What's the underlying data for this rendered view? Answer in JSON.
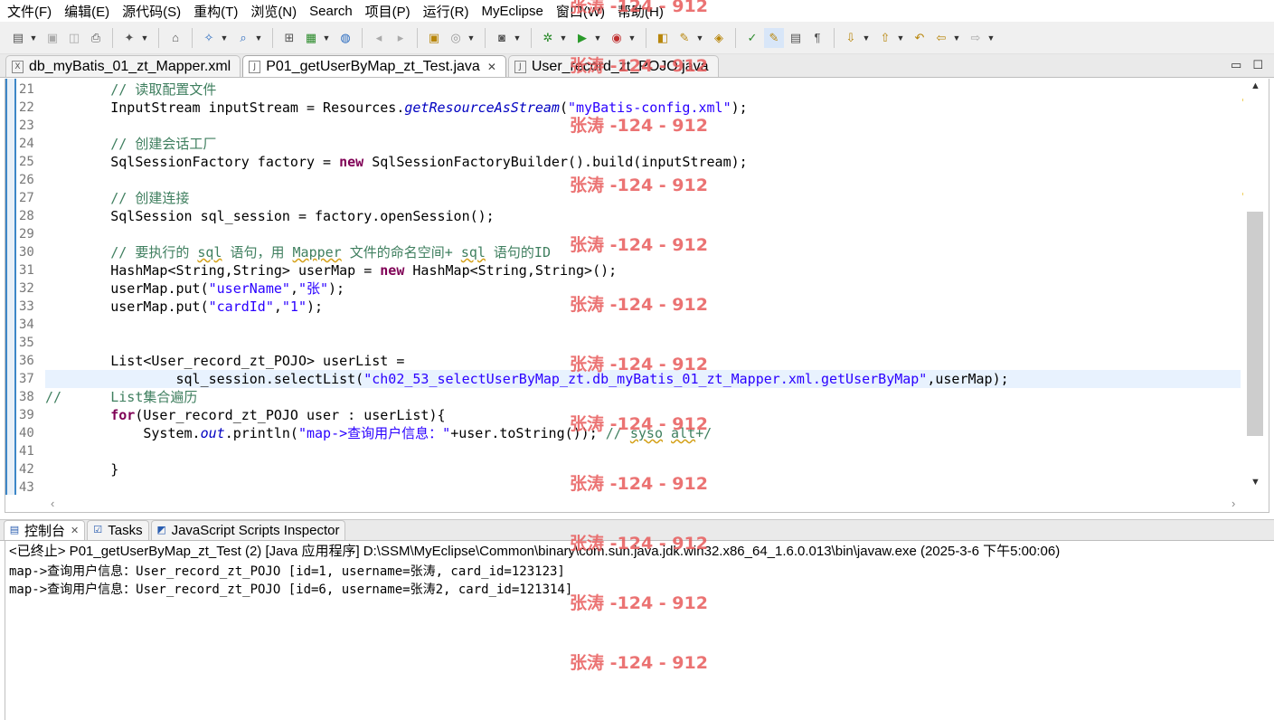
{
  "menu": {
    "items": [
      "文件(F)",
      "编辑(E)",
      "源代码(S)",
      "重构(T)",
      "浏览(N)",
      "Search",
      "项目(P)",
      "运行(R)",
      "MyEclipse",
      "窗口(W)",
      "帮助(H)"
    ]
  },
  "toolbar": {
    "buttons": [
      "new-icon",
      "save-icon",
      "save-all-icon",
      "print-icon",
      "new-project-icon",
      "terminal-icon",
      "open-type-icon",
      "search-icon",
      "deploy-icon",
      "server-icon",
      "globe-icon",
      "back-history-icon",
      "forward-history-icon",
      "package-icon",
      "browser-icon",
      "camera-icon",
      "debug-icon",
      "run-icon",
      "external-tools-icon",
      "open-folder-icon",
      "pen-icon",
      "bag-icon",
      "annotation-icon",
      "highlight-icon",
      "block-icon",
      "format-icon",
      "next-annotation-icon",
      "prev-annotation-icon",
      "last-edit-icon",
      "back-icon",
      "forward-icon"
    ]
  },
  "editor_tabs": [
    {
      "label": "db_myBatis_01_zt_Mapper.xml",
      "icon": "X",
      "active": false,
      "closable": false
    },
    {
      "label": "P01_getUserByMap_zt_Test.java",
      "icon": "J",
      "active": true,
      "closable": true
    },
    {
      "label": "User_record_zt_POJO.java",
      "icon": "J",
      "active": false,
      "closable": false
    }
  ],
  "window_controls": {
    "minimize": "▭",
    "maximize": "☐"
  },
  "code_lines": [
    {
      "no": "21",
      "text": "        // 读取配置文件"
    },
    {
      "no": "22",
      "text": "        InputStream inputStream = Resources.getResourceAsStream(\"myBatis-config.xml\");"
    },
    {
      "no": "23",
      "text": ""
    },
    {
      "no": "24",
      "text": "        // 创建会话工厂"
    },
    {
      "no": "25",
      "text": "        SqlSessionFactory factory = new SqlSessionFactoryBuilder().build(inputStream);"
    },
    {
      "no": "26",
      "text": ""
    },
    {
      "no": "27",
      "text": "        // 创建连接"
    },
    {
      "no": "28",
      "text": "        SqlSession sql_session = factory.openSession();"
    },
    {
      "no": "29",
      "text": ""
    },
    {
      "no": "30",
      "text": "        // 要执行的 sql 语句，用 Mapper 文件的命名空间+ sql 语句的ID"
    },
    {
      "no": "31",
      "text": "        HashMap<String,String> userMap = new HashMap<String,String>();"
    },
    {
      "no": "32",
      "text": "        userMap.put(\"userName\",\"张\");"
    },
    {
      "no": "33",
      "text": "        userMap.put(\"cardId\",\"1\");"
    },
    {
      "no": "34",
      "text": ""
    },
    {
      "no": "35",
      "text": ""
    },
    {
      "no": "36",
      "text": "        List<User_record_zt_POJO> userList ="
    },
    {
      "no": "37",
      "text": "                sql_session.selectList(\"ch02_53_selectUserByMap_zt.db_myBatis_01_zt_Mapper.xml.getUserByMap\",userMap);"
    },
    {
      "no": "38",
      "text": "//      List集合遍历"
    },
    {
      "no": "39",
      "text": "        for(User_record_zt_POJO user : userList){"
    },
    {
      "no": "40",
      "text": "            System.out.println(\"map->查询用户信息：\"+user.toString()); // syso alt+/"
    },
    {
      "no": "41",
      "text": ""
    },
    {
      "no": "42",
      "text": "        }"
    },
    {
      "no": "43",
      "text": ""
    }
  ],
  "code_spans": {
    "l21": [
      "// 读取配置文件"
    ],
    "l22": [
      "InputStream inputStream = Resources.",
      "getResourceAsStream",
      "(",
      "\"myBatis-config.xml\"",
      ");"
    ],
    "l24": [
      "// 创建会话工厂"
    ],
    "l25": [
      "SqlSessionFactory factory = ",
      "new",
      " SqlSessionFactoryBuilder().build(inputStream);"
    ],
    "l27": [
      "// 创建连接"
    ],
    "l28": [
      "SqlSession sql_session = factory.openSession();"
    ],
    "l30": [
      "// 要执行的 ",
      "sql",
      " 语句，用 ",
      "Mapper",
      " 文件的命名空间+ ",
      "sql",
      " 语句的ID"
    ],
    "l31": [
      "HashMap<String,String> userMap = ",
      "new",
      " HashMap<String,String>();"
    ],
    "l32": [
      "userMap.put(",
      "\"userName\"",
      ",",
      "\"张\"",
      ");"
    ],
    "l33": [
      "userMap.put(",
      "\"cardId\"",
      ",",
      "\"1\"",
      ");"
    ],
    "l36": [
      "List<User_record_zt_POJO> userList ="
    ],
    "l37": [
      "sql_session.selectList(",
      "\"ch02_53_selectUserByMap_zt.db_myBatis_01_zt_Mapper.xml.getUserByMap\"",
      ",userMap);"
    ],
    "l38a": [
      "//"
    ],
    "l38b": [
      "List集合遍历"
    ],
    "l39": [
      "for",
      "(User_record_zt_POJO user : userList){"
    ],
    "l40": [
      "System.",
      "out",
      ".println(",
      "\"map->查询用户信息：\"",
      "+user.toString()); ",
      "// ",
      "syso",
      " ",
      "alt",
      "+/"
    ],
    "l42": [
      "}"
    ]
  },
  "panel_tabs": [
    {
      "label": "控制台",
      "icon": "console-icon",
      "active": true,
      "closable": true
    },
    {
      "label": "Tasks",
      "icon": "tasks-icon",
      "active": false,
      "closable": false
    },
    {
      "label": "JavaScript Scripts Inspector",
      "icon": "js-inspector-icon",
      "active": false,
      "closable": false
    }
  ],
  "console": {
    "status": "<已终止> P01_getUserByMap_zt_Test (2)  [Java 应用程序] D:\\SSM\\MyEclipse\\Common\\binary\\com.sun.java.jdk.win32.x86_64_1.6.0.013\\bin\\javaw.exe (2025-3-6 下午5:00:06)",
    "lines": [
      "map->查询用户信息：User_record_zt_POJO [id=1, username=张涛, card_id=123123]",
      "map->查询用户信息：User_record_zt_POJO [id=6, username=张涛2, card_id=121314]"
    ]
  },
  "watermark": {
    "text": "张涛 -124 - 912",
    "color": "#e85a5a"
  },
  "colors": {
    "comment": "#3f7f5f",
    "keyword": "#7f0055",
    "string": "#2a00ff",
    "current_line": "#e8f2fe"
  }
}
